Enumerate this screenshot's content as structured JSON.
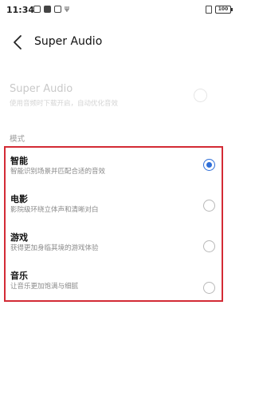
{
  "status_bar": {
    "time": "11:34",
    "battery": "100"
  },
  "header": {
    "title": "Super Audio"
  },
  "super_audio": {
    "title": "Super Audio",
    "description": "使用音频时下载开启，自动优化音效",
    "enabled": false
  },
  "section_label": "模式",
  "modes": [
    {
      "name": "智能",
      "desc": "智能识别场景并匹配合适的音效",
      "selected": true
    },
    {
      "name": "电影",
      "desc": "影院级环绕立体声和清晰对白",
      "selected": false
    },
    {
      "name": "游戏",
      "desc": "获得更加身临其境的游戏体验",
      "selected": false
    },
    {
      "name": "音乐",
      "desc": "让音乐更加饱满与细腻",
      "selected": false
    }
  ],
  "colors": {
    "accent": "#2f6fd8",
    "highlight_border": "#d32b35"
  }
}
